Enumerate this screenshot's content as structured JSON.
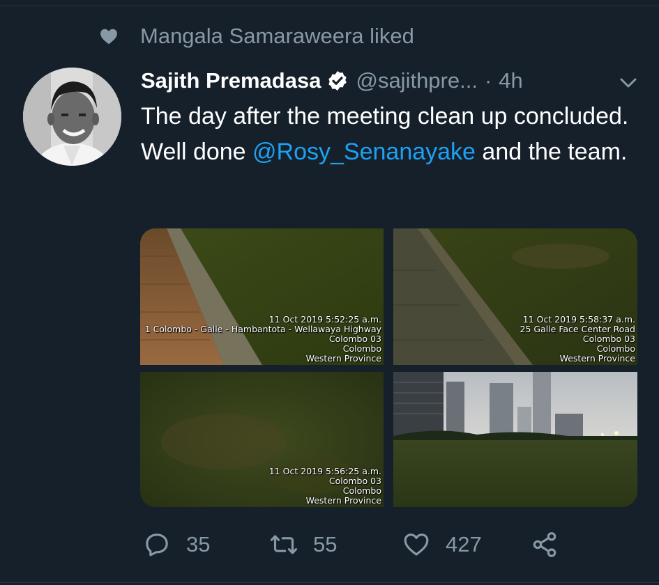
{
  "social_context": {
    "text": "Mangala Samaraweera liked",
    "icon": "heart-icon"
  },
  "tweet": {
    "author_name": "Sajith Premadasa",
    "handle": "@sajithpre...",
    "separator": "·",
    "time": "4h",
    "text_part1": "The day after the meeting clean up concluded. Well done ",
    "mention": "@Rosy_Senanayake",
    "text_part2": " and the team.",
    "media": [
      {
        "date": "11 Oct 2019 5:52:25 a.m.",
        "lines": [
          "1 Colombo - Galle - Hambantota - Wellawaya Highway",
          "Colombo 03",
          "Colombo",
          "Western Province"
        ]
      },
      {
        "date": "11 Oct 2019 5:58:37 a.m.",
        "lines": [
          "25 Galle Face Center Road",
          "Colombo 03",
          "Colombo",
          "Western Province"
        ]
      },
      {
        "date": "11 Oct 2019 5:56:25 a.m.",
        "lines": [
          "Colombo 03",
          "Colombo",
          "Western Province"
        ]
      },
      {
        "date": "",
        "lines": []
      }
    ],
    "counts": {
      "replies": "35",
      "retweets": "55",
      "likes": "427"
    }
  },
  "colors": {
    "background": "#15202b",
    "secondary_text": "#8899a6",
    "link": "#1da1f2"
  }
}
